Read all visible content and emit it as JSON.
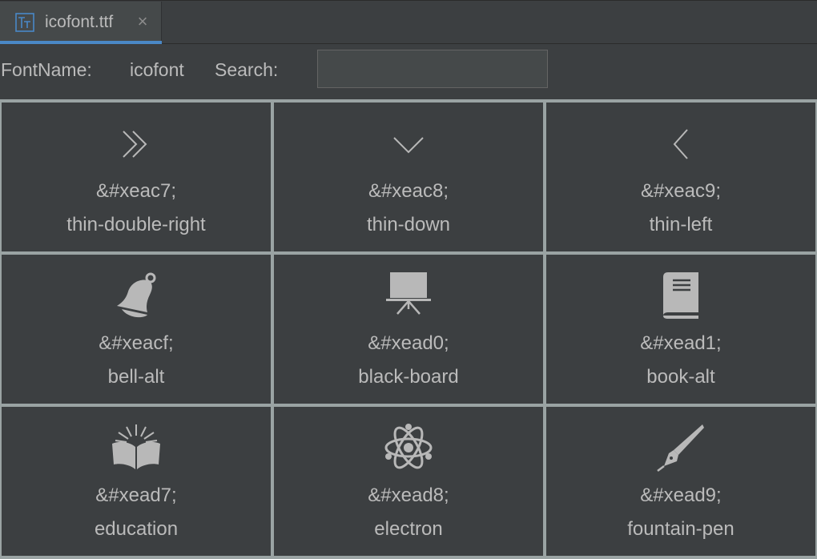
{
  "tab": {
    "title": "icofont.ttf",
    "close": "×"
  },
  "toolbar": {
    "fontname_label": "FontName:",
    "fontname_value": "icofont",
    "search_label": "Search:",
    "search_value": "",
    "search_placeholder": ""
  },
  "colors": {
    "accent": "#4a88c7",
    "background": "#3c3f41",
    "grid_line": "#9aa3a3",
    "text": "#bbbbbb"
  },
  "glyphs": [
    {
      "code": "&#xeac7;",
      "name": "thin-double-right",
      "icon": "thin-double-right-icon"
    },
    {
      "code": "&#xeac8;",
      "name": "thin-down",
      "icon": "thin-down-icon"
    },
    {
      "code": "&#xeac9;",
      "name": "thin-left",
      "icon": "thin-left-icon"
    },
    {
      "code": "&#xeacf;",
      "name": "bell-alt",
      "icon": "bell-alt-icon"
    },
    {
      "code": "&#xead0;",
      "name": "black-board",
      "icon": "black-board-icon"
    },
    {
      "code": "&#xead1;",
      "name": "book-alt",
      "icon": "book-alt-icon"
    },
    {
      "code": "&#xead7;",
      "name": "education",
      "icon": "education-icon"
    },
    {
      "code": "&#xead8;",
      "name": "electron",
      "icon": "electron-icon"
    },
    {
      "code": "&#xead9;",
      "name": "fountain-pen",
      "icon": "fountain-pen-icon"
    }
  ]
}
